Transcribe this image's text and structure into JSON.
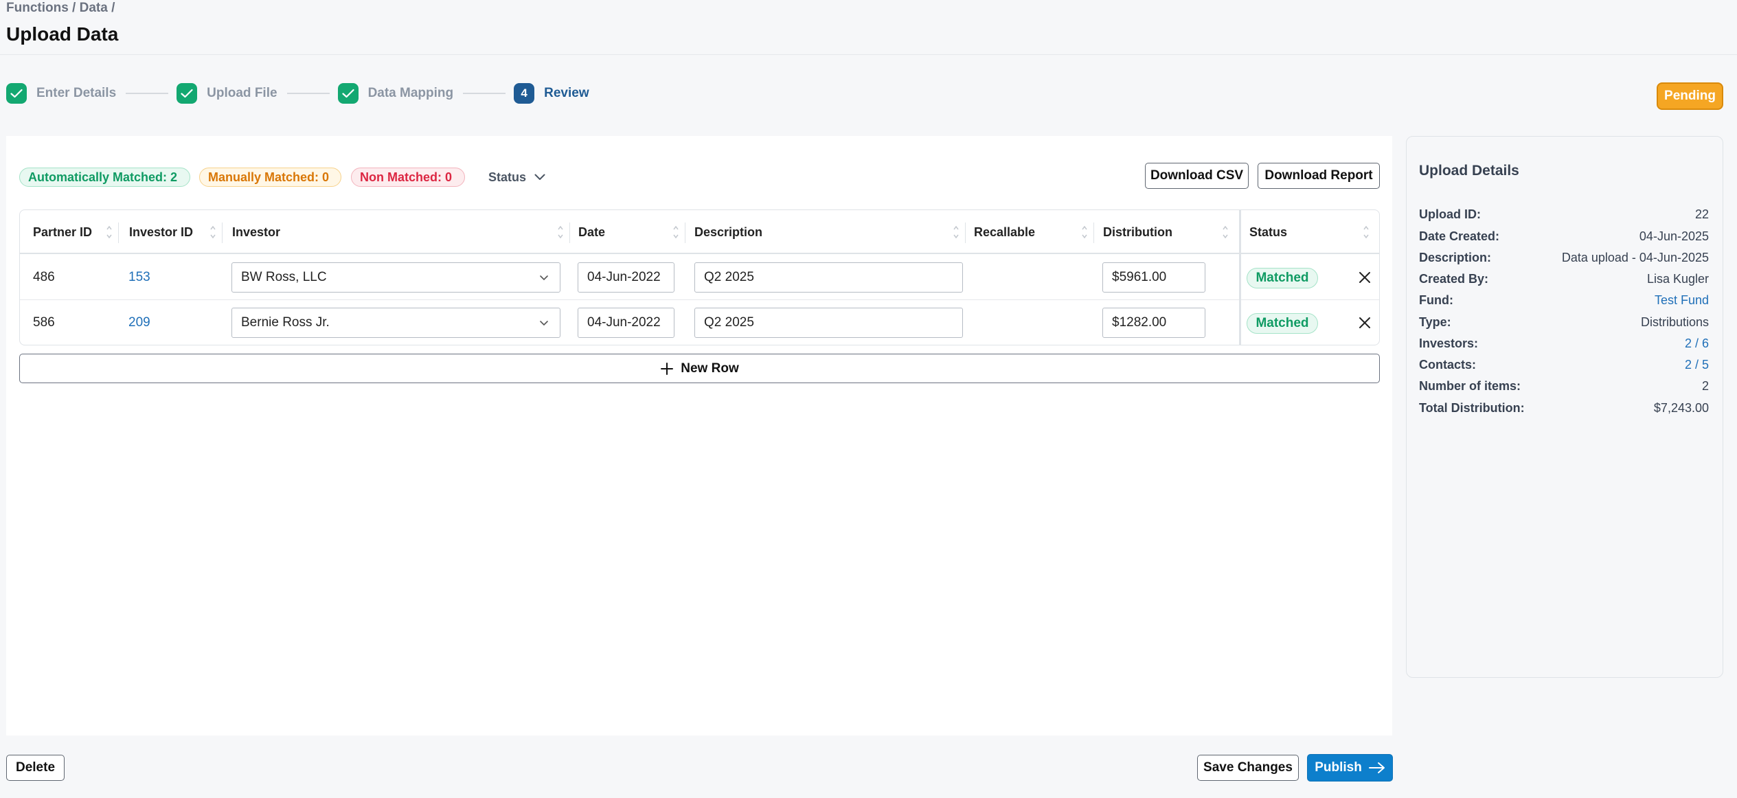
{
  "header": {
    "breadcrumb": "Functions / Data /",
    "title": "Upload Data"
  },
  "stepper": {
    "steps": [
      {
        "label": "Enter Details",
        "state": "done"
      },
      {
        "label": "Upload File",
        "state": "done"
      },
      {
        "label": "Data Mapping",
        "state": "done"
      },
      {
        "label": "Review",
        "state": "active",
        "number": "4"
      }
    ]
  },
  "status_badge": "Pending",
  "filters": {
    "auto_matched": "Automatically Matched: 2",
    "manual_matched": "Manually Matched: 0",
    "non_matched": "Non Matched: 0",
    "status_label": "Status"
  },
  "toolbar": {
    "download_csv": "Download CSV",
    "download_report": "Download Report"
  },
  "table": {
    "columns": [
      "Partner ID",
      "Investor ID",
      "Investor",
      "Date",
      "Description",
      "Recallable",
      "Distribution",
      "Status"
    ],
    "rows": [
      {
        "partner_id": "486",
        "investor_id": "153",
        "investor": "BW Ross, LLC",
        "date": "04-Jun-2022",
        "description": "Q2 2025",
        "recallable": "",
        "distribution": "$5961.00",
        "status": "Matched"
      },
      {
        "partner_id": "586",
        "investor_id": "209",
        "investor": "Bernie Ross Jr.",
        "date": "04-Jun-2022",
        "description": "Q2 2025",
        "recallable": "",
        "distribution": "$1282.00",
        "status": "Matched"
      }
    ],
    "new_row_label": "New Row"
  },
  "upload_details": {
    "title": "Upload Details",
    "items": [
      {
        "label": "Upload ID:",
        "value": "22"
      },
      {
        "label": "Date Created:",
        "value": "04-Jun-2025"
      },
      {
        "label": "Description:",
        "value": "Data upload - 04-Jun-2025"
      },
      {
        "label": "Created By:",
        "value": "Lisa Kugler"
      },
      {
        "label": "Fund:",
        "value": "Test Fund"
      },
      {
        "label": "Type:",
        "value": "Distributions"
      },
      {
        "label": "Investors:",
        "value": "2 / 6"
      },
      {
        "label": "Contacts:",
        "value": "2 / 5"
      },
      {
        "label": "Number of items:",
        "value": "2"
      },
      {
        "label": "Total Distribution:",
        "value": "$7,243.00"
      }
    ]
  },
  "footer": {
    "delete": "Delete",
    "save": "Save Changes",
    "publish": "Publish"
  },
  "colors": {
    "success": "#13a871",
    "active_step": "#1f5b94",
    "pending": "#f5a623",
    "primary": "#0d7fcc",
    "link": "#1f6fb8"
  }
}
